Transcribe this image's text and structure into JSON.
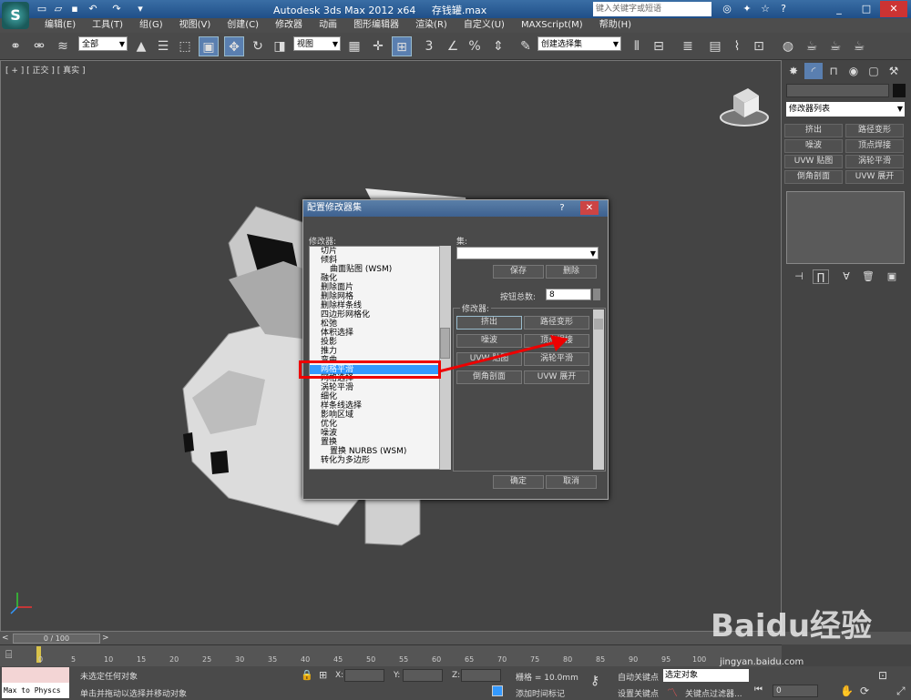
{
  "titlebar": {
    "app_title": "Autodesk 3ds Max  2012 x64",
    "file_name": "存钱罐.max",
    "search_placeholder": "键入关键字或短语",
    "min": "_",
    "max": "□",
    "close": "✕"
  },
  "menubar": [
    "编辑(E)",
    "工具(T)",
    "组(G)",
    "视图(V)",
    "创建(C)",
    "修改器",
    "动画",
    "图形编辑器",
    "渲染(R)",
    "自定义(U)",
    "MAXScript(M)",
    "帮助(H)"
  ],
  "toolbar": {
    "selection_filter": "全部",
    "ref_coord": "视图",
    "named_selection": "创建选择集",
    "snap3": "3",
    "snap_pct": "%"
  },
  "viewport": {
    "label": "[ + ] [ 正交 ] [ 真实 ]"
  },
  "command_panel": {
    "modifier_list": "修改器列表",
    "buttons": [
      "挤出",
      "路径变形",
      "噪波",
      "顶点焊接",
      "UVW 贴图",
      "涡轮平滑",
      "倒角剖面",
      "UVW 展开"
    ]
  },
  "dialog": {
    "title": "配置修改器集",
    "help": "?",
    "close": "✕",
    "modifiers_label": "修改器:",
    "modifiers": [
      {
        "label": "切片",
        "indent": false,
        "selected": false
      },
      {
        "label": "倾斜",
        "indent": false,
        "selected": false
      },
      {
        "label": "曲面贴图 (WSM)",
        "indent": true,
        "selected": false
      },
      {
        "label": "融化",
        "indent": false,
        "selected": false
      },
      {
        "label": "删除面片",
        "indent": false,
        "selected": false
      },
      {
        "label": "删除网格",
        "indent": false,
        "selected": false
      },
      {
        "label": "删除样条线",
        "indent": false,
        "selected": false
      },
      {
        "label": "四边形网格化",
        "indent": false,
        "selected": false
      },
      {
        "label": "松弛",
        "indent": false,
        "selected": false
      },
      {
        "label": "体积选择",
        "indent": false,
        "selected": false
      },
      {
        "label": "投影",
        "indent": false,
        "selected": false
      },
      {
        "label": "推力",
        "indent": false,
        "selected": false
      },
      {
        "label": "弯曲",
        "indent": false,
        "selected": false
      },
      {
        "label": "网格平滑",
        "indent": false,
        "selected": true
      },
      {
        "label": "网格选择",
        "indent": false,
        "selected": false
      },
      {
        "label": "涡轮平滑",
        "indent": false,
        "selected": false
      },
      {
        "label": "细化",
        "indent": false,
        "selected": false
      },
      {
        "label": "样条线选择",
        "indent": false,
        "selected": false
      },
      {
        "label": "影响区域",
        "indent": false,
        "selected": false
      },
      {
        "label": "优化",
        "indent": false,
        "selected": false
      },
      {
        "label": "噪波",
        "indent": false,
        "selected": false
      },
      {
        "label": "置换",
        "indent": false,
        "selected": false
      },
      {
        "label": "置换 NURBS (WSM)",
        "indent": true,
        "selected": false
      },
      {
        "label": "转化为多边形",
        "indent": false,
        "selected": false
      }
    ],
    "sets_label": "集:",
    "set_value": "",
    "save": "保存",
    "delete": "删除",
    "button_count_label": "按钮总数:",
    "button_count": "8",
    "modifiers_group_label": "修改器:",
    "group_buttons": [
      "挤出",
      "路径变形",
      "噪波",
      "顶点焊接",
      "UVW 贴图",
      "涡轮平滑",
      "倒角剖面",
      "UVW 展开"
    ],
    "ok": "确定",
    "cancel": "取消"
  },
  "timeline": {
    "frame": "0 / 100",
    "ticks": [
      "0",
      "5",
      "10",
      "15",
      "20",
      "25",
      "30",
      "35",
      "40",
      "45",
      "50",
      "55",
      "60",
      "65",
      "70",
      "75",
      "80",
      "85",
      "90",
      "95",
      "100"
    ]
  },
  "statusbar": {
    "maxscript": "Max to Physcs",
    "status1": "未选定任何对象",
    "status2": "单击并拖动以选择并移动对象",
    "x_label": "X:",
    "y_label": "Y:",
    "z_label": "Z:",
    "grid": "栅格 = 10.0mm",
    "add_time_tag": "添加时间标记",
    "auto_key": "自动关键点",
    "selected_obj": "选定对象",
    "set_key": "设置关键点",
    "key_filter": "关键点过滤器...",
    "frame_value": "0"
  },
  "watermark": {
    "logo": "Baidu经验",
    "url": "jingyan.baidu.com"
  }
}
